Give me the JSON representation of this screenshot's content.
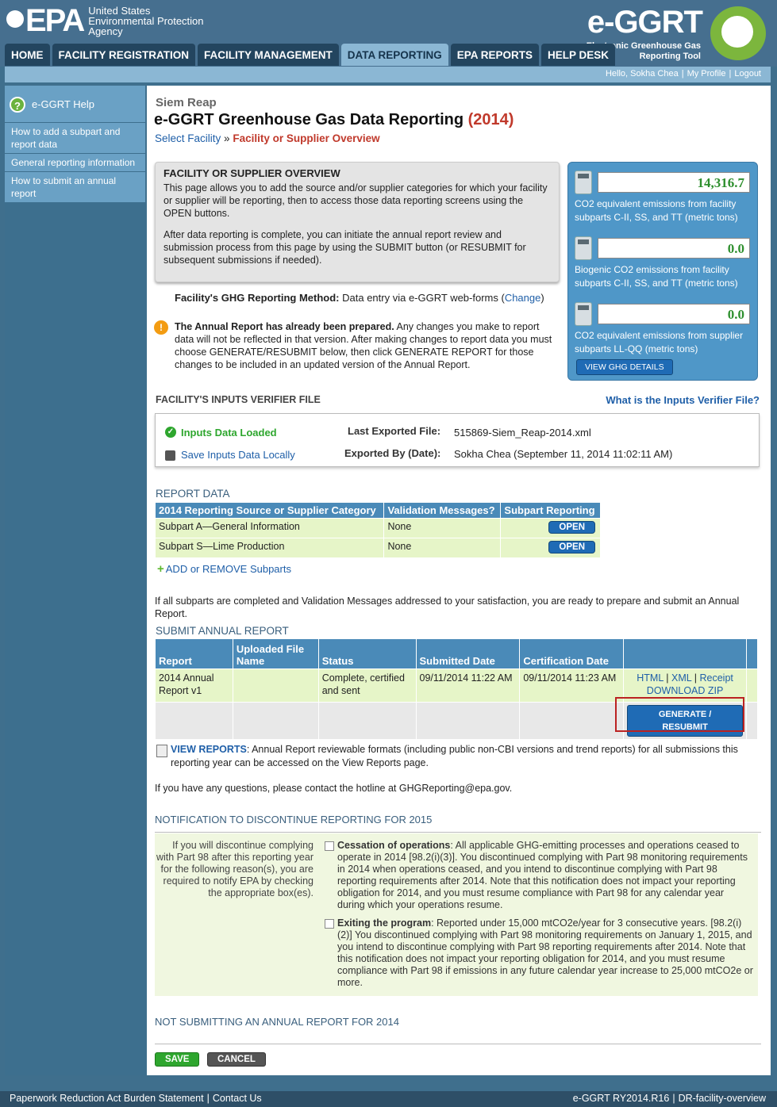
{
  "header": {
    "logo_mark": "EPA",
    "agency_line1": "United States",
    "agency_line2": "Environmental Protection",
    "agency_line3": "Agency",
    "app_name": "e-GGRT",
    "app_sub1": "Electronic Greenhouse Gas",
    "app_sub2": "Reporting Tool"
  },
  "nav": {
    "home": "HOME",
    "fac_reg": "FACILITY REGISTRATION",
    "fac_mgmt": "FACILITY MANAGEMENT",
    "data_rep": "DATA REPORTING",
    "epa_rep": "EPA REPORTS",
    "help": "HELP DESK"
  },
  "user": {
    "hello": "Hello, Sokha Chea",
    "profile": "My Profile",
    "logout": "Logout"
  },
  "sidebar": {
    "help_title": "e-GGRT Help",
    "items": [
      "How to add a subpart and report data",
      "General reporting information",
      "How to submit an annual report"
    ]
  },
  "page": {
    "facility": "Siem Reap",
    "title": "e-GGRT Greenhouse Gas Data Reporting",
    "year": "(2014)",
    "crumb_link": "Select Facility",
    "crumb_sep": "»",
    "crumb_current": "Facility or Supplier Overview"
  },
  "overview": {
    "heading": "FACILITY OR SUPPLIER OVERVIEW",
    "p1": "This page allows you to add the source and/or supplier categories for which your facility or supplier will be reporting, then to access those data reporting screens using the OPEN buttons.",
    "p2": "After data reporting is complete, you can initiate the annual report review and submission process from this page by using the SUBMIT button (or RESUBMIT for subsequent submissions if needed)."
  },
  "ghg": {
    "v1": "14,316.7",
    "l1": "CO2 equivalent emissions from facility subparts C-II, SS, and TT (metric tons)",
    "v2": "0.0",
    "l2": "Biogenic CO2 emissions from facility subparts C-II, SS, and TT (metric tons)",
    "v3": "0.0",
    "l3": "CO2 equivalent emissions from supplier subparts LL-QQ (metric tons)",
    "details": "VIEW GHG DETAILS"
  },
  "method": {
    "label": "Facility's GHG Reporting Method:",
    "value": "Data entry via e-GGRT web-forms (",
    "change": "Change",
    ")": ")"
  },
  "warning": {
    "bold": "The Annual Report has already been prepared.",
    "text": " Any changes you make to report data will not be reflected in that version. After making changes to report data you must choose GENERATE/RESUBMIT below, then click GENERATE REPORT for those changes to be included in an updated version of the Annual Report."
  },
  "iv": {
    "heading": "FACILITY'S INPUTS VERIFIER FILE",
    "link": "What is the Inputs Verifier File?",
    "loaded": "Inputs Data Loaded",
    "save": "Save Inputs Data Locally",
    "k1": "Last Exported File:",
    "v1": "515869-Siem_Reap-2014.xml",
    "k2": "Exported By (Date):",
    "v2": "Sokha Chea (September 11, 2014 11:02:11 AM)"
  },
  "report_data": {
    "heading": "REPORT DATA",
    "cols": [
      "2014 Reporting Source or Supplier Category",
      "Validation Messages?",
      "Subpart Reporting"
    ],
    "rows": [
      {
        "cat": "Subpart A—General Information",
        "val": "None",
        "btn": "OPEN"
      },
      {
        "cat": "Subpart S—Lime Production",
        "val": "None",
        "btn": "OPEN"
      }
    ],
    "add": "ADD or REMOVE Subparts"
  },
  "ready_text": "If all subparts are completed and Validation Messages addressed to your satisfaction, you are ready to prepare and submit an Annual Report.",
  "submit": {
    "heading": "SUBMIT ANNUAL REPORT",
    "cols": [
      "Report",
      "Uploaded File Name",
      "Status",
      "Submitted Date",
      "Certification Date"
    ],
    "row": {
      "report": "2014 Annual Report v1",
      "file": "",
      "status": "Complete, certified and sent",
      "submitted": "09/11/2014 11:22 AM",
      "certified": "09/11/2014 11:23 AM",
      "html": "HTML",
      "xml": "XML",
      "receipt": "Receipt",
      "zip": "DOWNLOAD ZIP"
    },
    "generate": "GENERATE / RESUBMIT"
  },
  "view_reports": {
    "link": "VIEW REPORTS",
    "text": ": Annual Report reviewable formats (including public non-CBI versions and trend reports) for all submissions this reporting year can be accessed on the View Reports page."
  },
  "questions": "If you have any questions, please contact the hotline at GHGReporting@epa.gov.",
  "discontinue": {
    "heading": "NOTIFICATION TO DISCONTINUE REPORTING FOR 2015",
    "left": "If you will discontinue complying with Part 98 after this reporting year for the following reason(s), you are required to notify EPA by checking the appropriate box(es).",
    "o1b": "Cessation of operations",
    "o1": ": All applicable GHG-emitting processes and operations ceased to operate in 2014 [98.2(i)(3)]. You discontinued complying with Part 98 monitoring requirements in 2014 when operations ceased, and you intend to discontinue complying with Part 98 reporting requirements after 2014. Note that this notification does not impact your reporting obligation for 2014, and you must resume compliance with Part 98 for any calendar year during which your operations resume.",
    "o2b": "Exiting the program",
    "o2": ": Reported under 15,000 mtCO2e/year for 3 consecutive years. [98.2(i)(2)] You discontinued complying with Part 98 monitoring requirements on January 1, 2015, and you intend to discontinue complying with Part 98 reporting requirements after 2014. Note that this notification does not impact your reporting obligation for 2014, and you must resume compliance with Part 98 if emissions in any future calendar year increase to 25,000 mtCO2e or more."
  },
  "not_submitting": "NOT SUBMITTING AN ANNUAL REPORT FOR 2014",
  "buttons": {
    "save": "SAVE",
    "cancel": "CANCEL"
  },
  "footer": {
    "paperwork": "Paperwork Reduction Act Burden Statement",
    "contact": "Contact Us",
    "version": "e-GGRT RY2014.R16",
    "page_id": "DR-facility-overview"
  }
}
